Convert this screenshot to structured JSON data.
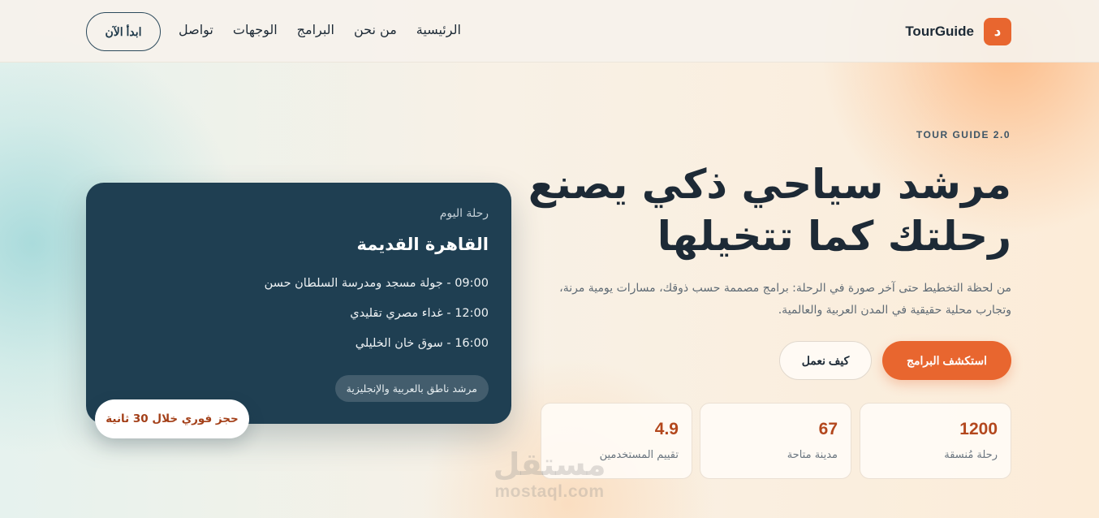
{
  "header": {
    "logo_mark": "د",
    "logo_text": "TourGuide",
    "nav": [
      {
        "label": "الرئيسية"
      },
      {
        "label": "من نحن"
      },
      {
        "label": "البرامج"
      },
      {
        "label": "الوجهات"
      },
      {
        "label": "تواصل"
      }
    ],
    "active_nav": "الرئيسية",
    "cta": "ابدأ الآن"
  },
  "hero": {
    "eyebrow": "TOUR GUIDE 2.0",
    "title_line1": "مرشد سياحي ذكي يصنع",
    "title_line2": "رحلتك كما تتخيلها",
    "description": "من لحظة التخطيط حتى آخر صورة في الرحلة: برامج مصممة حسب ذوقك، مسارات يومية مرنة، وتجارب محلية حقيقية في المدن العربية والعالمية.",
    "primary_button": "استكشف البرامج",
    "secondary_button": "كيف نعمل"
  },
  "stats": [
    {
      "value": "1200",
      "label": "رحلة مُنسقة"
    },
    {
      "value": "67",
      "label": "مدينة متاحة"
    },
    {
      "value": "4.9",
      "label": "تقييم المستخدمين"
    }
  ],
  "trip_card": {
    "kicker": "رحلة اليوم",
    "city": "القاهرة القديمة",
    "items": [
      "09:00 - جولة مسجد ومدرسة السلطان حسن",
      "12:00 - غداء مصري تقليدي",
      "16:00 - سوق خان الخليلي"
    ],
    "tag": "مرشد ناطق بالعربية والإنجليزية"
  },
  "badge": "حجز فوري خلال 30 ثانية",
  "watermark": {
    "ar": "مستقل",
    "en": "mostaql.com"
  },
  "colors": {
    "accent": "#e8662f",
    "accent_dark": "#b3471d",
    "navy": "#1f3f52",
    "text": "#1d2a36"
  }
}
